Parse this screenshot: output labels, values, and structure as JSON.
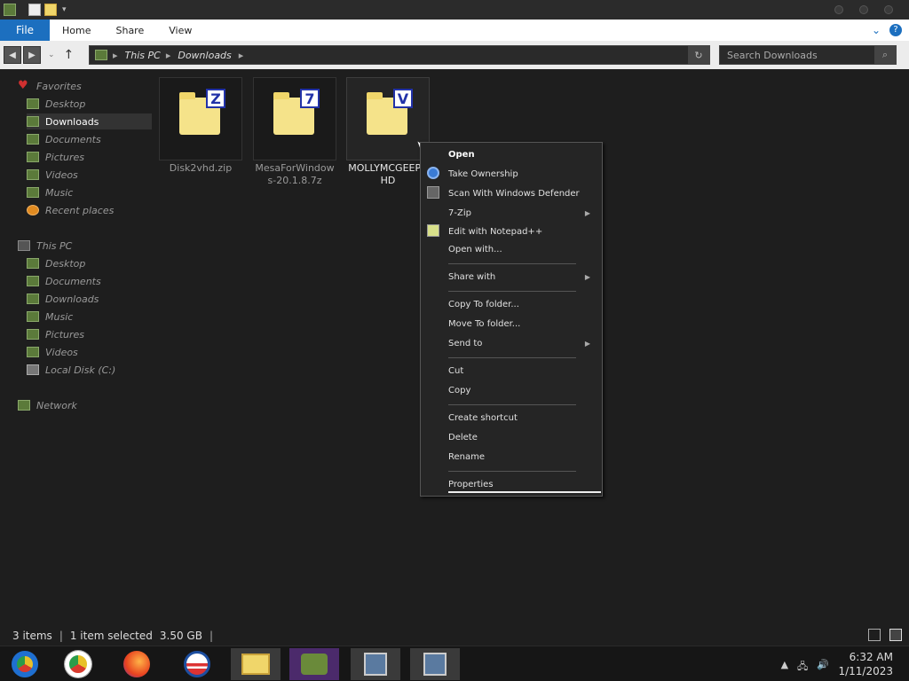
{
  "window": {
    "ribbon_tabs": {
      "file": "File",
      "home": "Home",
      "share": "Share",
      "view": "View"
    },
    "help_icon": "help-icon"
  },
  "navigation": {
    "breadcrumb": [
      "This PC",
      "Downloads"
    ],
    "search_placeholder": "Search Downloads"
  },
  "sidebar": {
    "favorites_label": "Favorites",
    "favorites": [
      "Desktop",
      "Downloads",
      "Documents",
      "Pictures",
      "Videos",
      "Music",
      "Recent places"
    ],
    "thispc_label": "This PC",
    "thispc": [
      "Desktop",
      "Documents",
      "Downloads",
      "Music",
      "Pictures",
      "Videos",
      "Local Disk (C:)"
    ],
    "network_label": "Network"
  },
  "files": [
    {
      "name": "Disk2vhd.zip",
      "badge": "Z"
    },
    {
      "name": "MesaForWindows-20.1.8.7z",
      "name_line1": "MesaForWindow",
      "name_line2": "s-20.1.8.7z",
      "badge": "7"
    },
    {
      "name": "MOLLYMCGEEPC.VHD",
      "name_line1": "MOLLYMCGEEPC",
      "name_line2": "HD",
      "badge": "V"
    }
  ],
  "context_menu": {
    "items": [
      {
        "label": "Open",
        "bold": true
      },
      {
        "label": "Take Ownership",
        "icon": "gear-icon"
      },
      {
        "label": "Scan With Windows Defender",
        "icon": "defender-icon"
      },
      {
        "label": "7-Zip",
        "submenu": true
      },
      {
        "label": "Edit with Notepad++",
        "icon": "notepad-icon"
      },
      {
        "label": "Open with..."
      },
      {
        "label": "Share with",
        "submenu": true
      },
      {
        "label": "Copy To folder..."
      },
      {
        "label": "Move To folder..."
      },
      {
        "label": "Send to",
        "submenu": true
      },
      {
        "label": "Cut"
      },
      {
        "label": "Copy"
      },
      {
        "label": "Create shortcut"
      },
      {
        "label": "Delete"
      },
      {
        "label": "Rename"
      },
      {
        "label": "Properties"
      }
    ]
  },
  "status": {
    "item_count": "3 items",
    "selection": "1 item selected",
    "size": "3.50 GB"
  },
  "taskbar": {
    "apps": [
      "chrome-canary-icon",
      "chrome-icon",
      "firefox-icon",
      "obama-logo-icon",
      "file-explorer-icon",
      "network-manager-icon",
      "installer-icon",
      "installer-icon"
    ],
    "time": "6:32 AM",
    "date": "1/11/2023"
  },
  "colors": {
    "accent": "#1c6fbf",
    "background": "#1e1e1e"
  }
}
